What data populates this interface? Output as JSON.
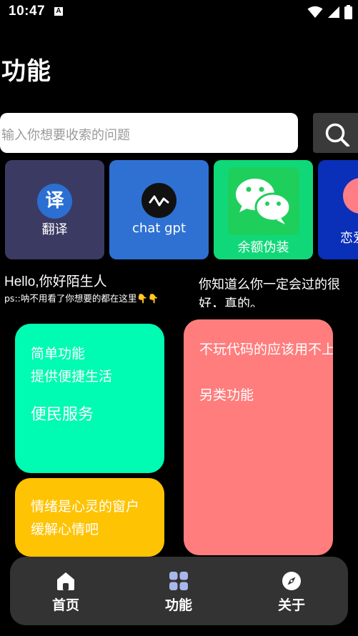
{
  "status_bar": {
    "time": "10:47",
    "notification_icon": "A",
    "icons": [
      "wifi-icon",
      "signal-icon",
      "battery-icon"
    ]
  },
  "page": {
    "title": "功能"
  },
  "search": {
    "placeholder": "输入你想要收索的问题",
    "button_icon": "search-icon"
  },
  "feature_cards": [
    {
      "label": "翻译",
      "icon_text": "译",
      "icon": "translate-icon",
      "color": "#3b3a63"
    },
    {
      "label": "chat gpt",
      "icon": "chatgpt-icon",
      "color": "#2f71d3"
    },
    {
      "label": "余额伪装",
      "icon": "wechat-icon",
      "color": "#10d879"
    },
    {
      "label": "恋爱",
      "icon": "love-icon",
      "color": "#0a2fb8"
    }
  ],
  "greeting": {
    "title": "Hello,你好陌生人",
    "subtitle": "ps::呐不用看了你想要的都在这里👇👇"
  },
  "marquee": {
    "text": "你知道么你一定会过的很好，真的。"
  },
  "tiles": {
    "green": {
      "line1": "简单功能",
      "line2": "提供便捷生活",
      "heading": "便民服务",
      "color": "#00fbb2"
    },
    "pink": {
      "line1": "不玩代码的应该用不上",
      "line2": "另类功能",
      "color": "#ff7d7d"
    },
    "yellow": {
      "line1": "情绪是心灵的窗户",
      "line2": "缓解心情吧",
      "color": "#fec302"
    }
  },
  "bottom_nav": {
    "items": [
      {
        "label": "首页",
        "icon": "home-icon"
      },
      {
        "label": "功能",
        "icon": "grid-icon",
        "active": true
      },
      {
        "label": "关于",
        "icon": "compass-icon"
      }
    ],
    "active_color": "#a9b8ec"
  }
}
